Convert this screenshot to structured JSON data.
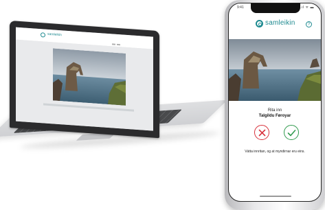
{
  "laptop": {
    "site_logo_text": "samleikin"
  },
  "phone": {
    "status": {
      "time": "9:41",
      "icons": "..ıl ᯤ ▬"
    },
    "brand": {
      "name": "samleikin"
    },
    "help_symbol": "?",
    "prompt": {
      "sign_in_label": "Rita inn",
      "service_name": "Talgildu Føroyar",
      "instruction": "Vátta innritan, og at myndirnar eru eins."
    }
  },
  "colors": {
    "brand": "#1e8a90",
    "reject": "#d8303a",
    "approve": "#2f9a4d"
  },
  "icons": [
    "samleikin-logo-icon",
    "help-icon",
    "reject-x-icon",
    "approve-check-icon"
  ]
}
